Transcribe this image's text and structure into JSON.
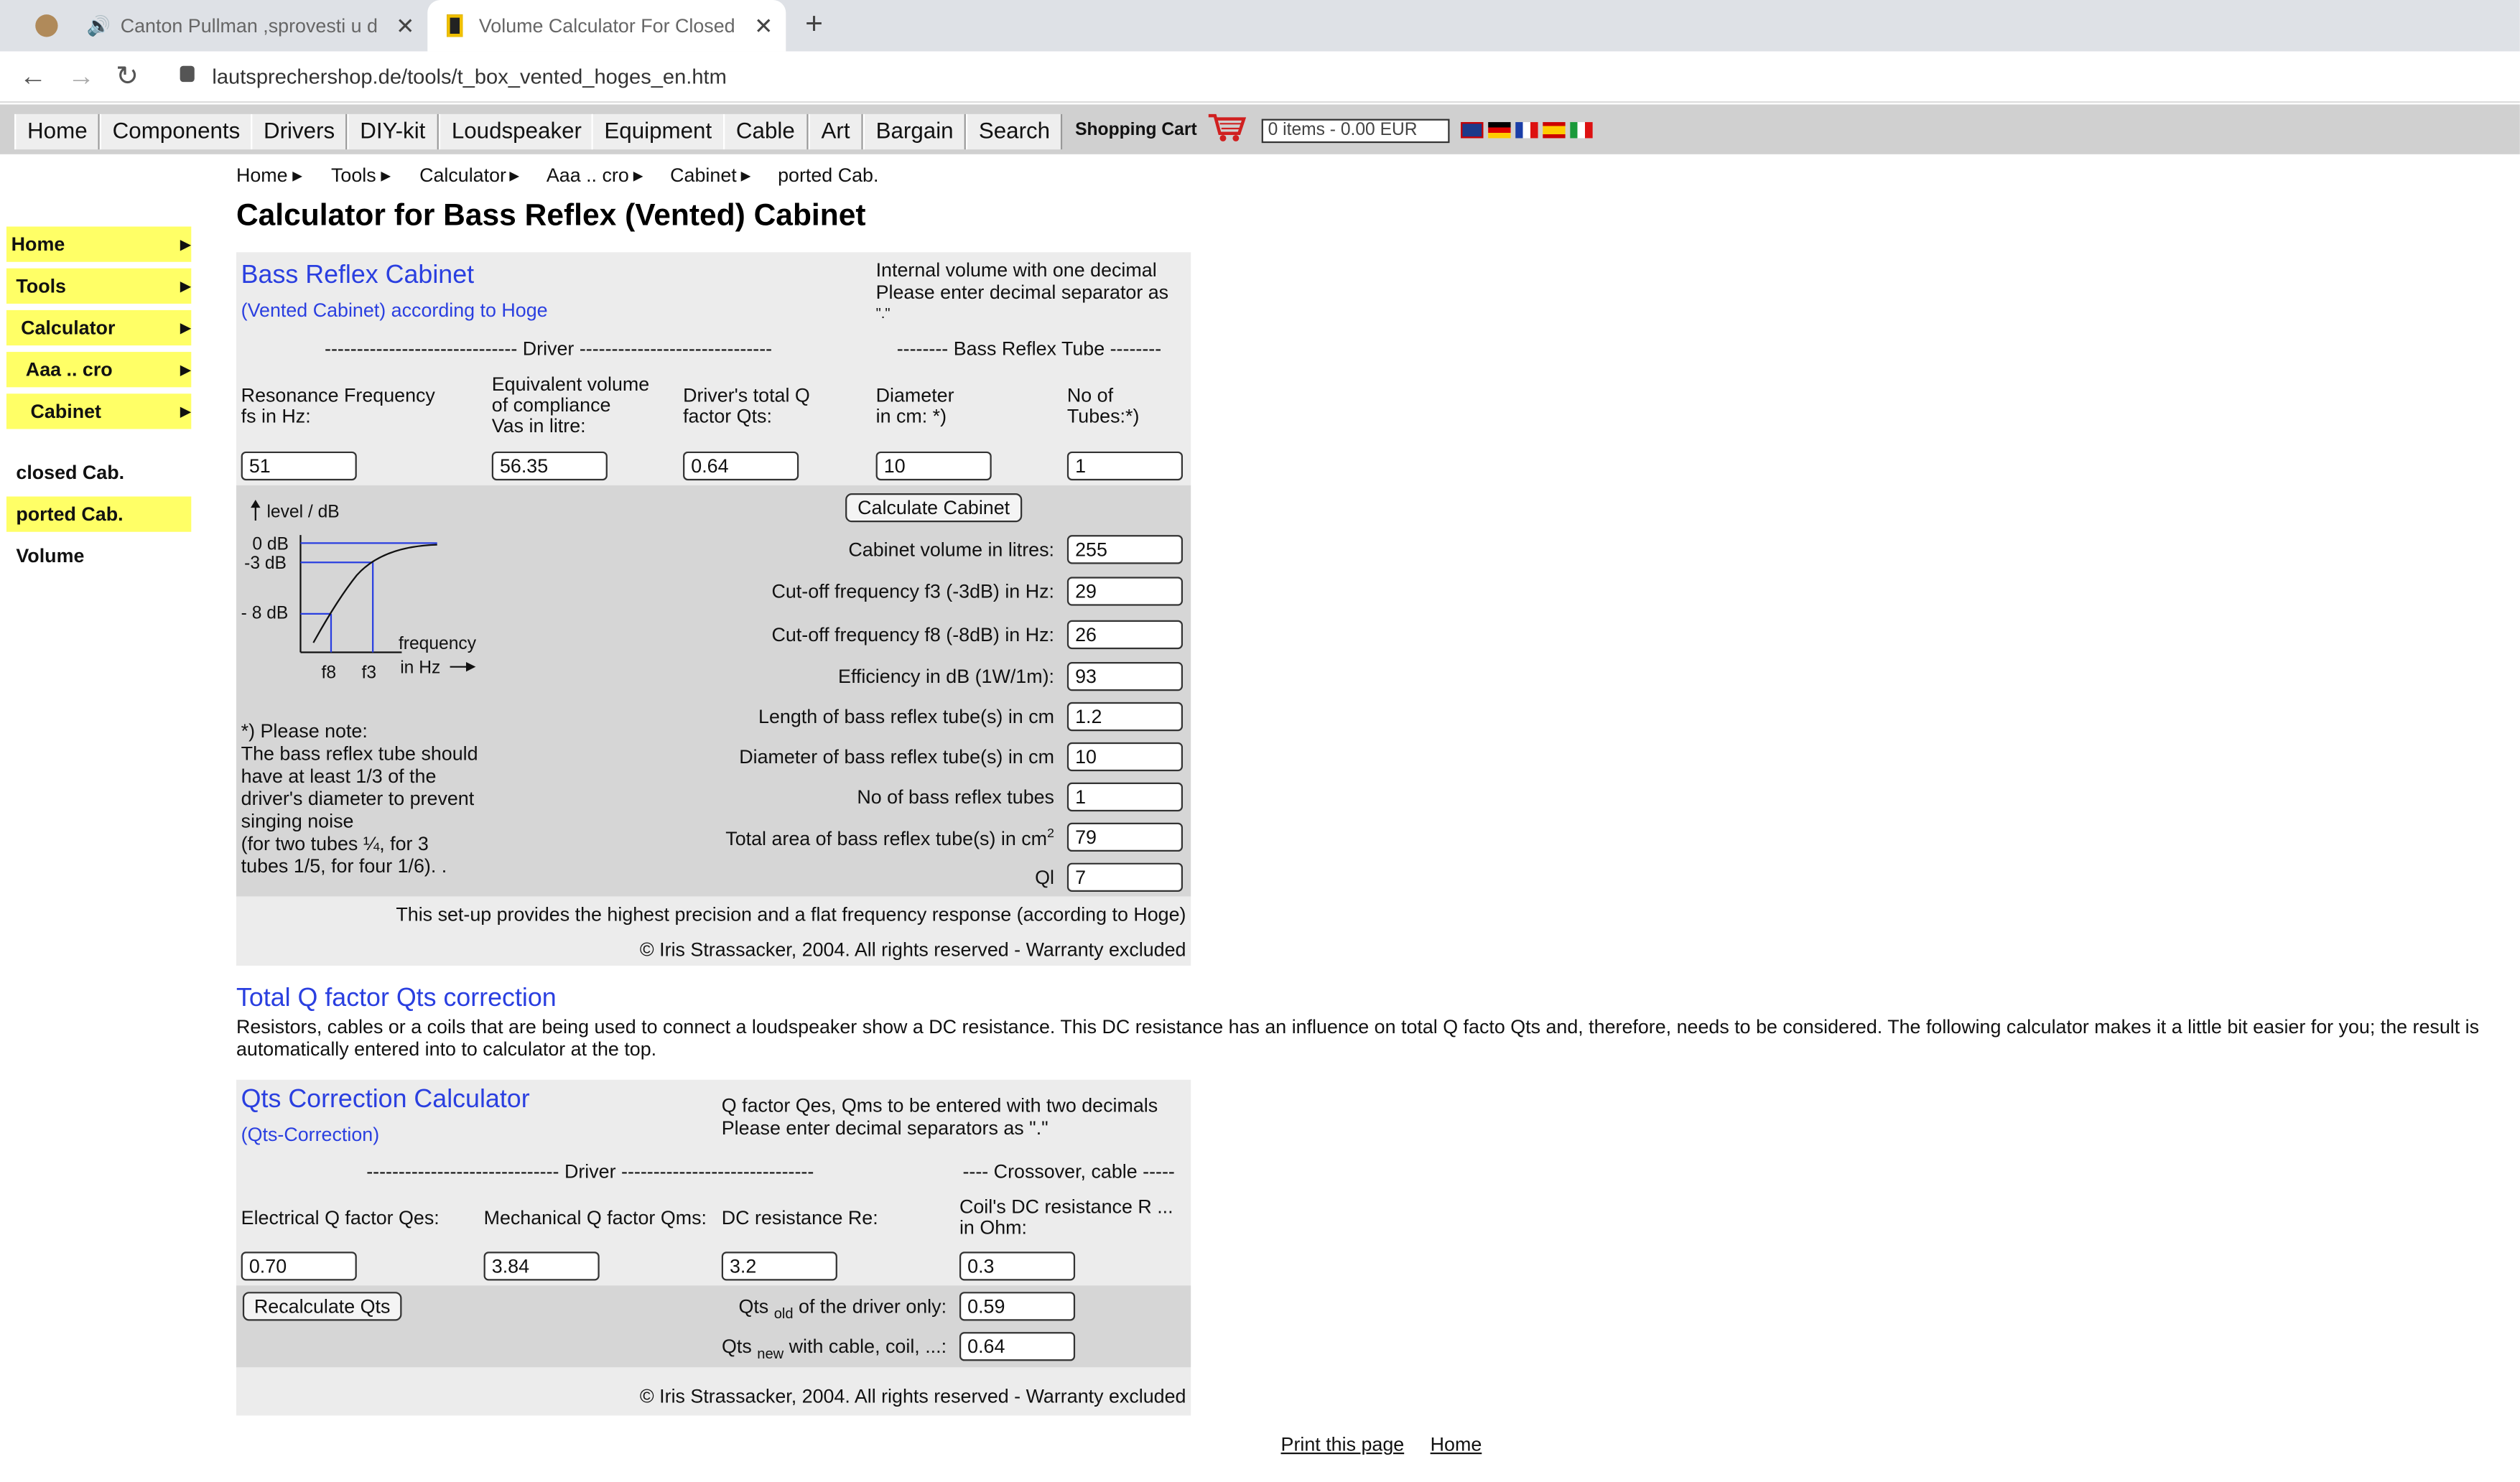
{
  "browser": {
    "tabs": [
      {
        "title": "Canton Pullman ,sprovesti u delo"
      },
      {
        "title": "Volume Calculator For Closed Lo"
      }
    ],
    "url": "lautsprechershop.de/tools/t_box_vented_hoges_en.htm"
  },
  "site_nav": {
    "items": [
      "Home",
      "Components",
      "Drivers",
      "DIY-kit",
      "Loudspeaker",
      "Equipment",
      "Cable",
      "Art",
      "Bargain",
      "Search"
    ],
    "cart_label": "Shopping Cart",
    "cart_value": "0 items - 0.00 EUR"
  },
  "sidebar": {
    "items": [
      {
        "label": "Home"
      },
      {
        "label": "Tools"
      },
      {
        "label": "Calculator"
      },
      {
        "label": "Aaa .. cro"
      },
      {
        "label": "Cabinet"
      },
      {
        "label": "closed Cab."
      },
      {
        "label": "ported Cab."
      },
      {
        "label": "Volume"
      }
    ]
  },
  "breadcrumb": [
    "Home",
    "Tools",
    "Calculator",
    "Aaa .. cro",
    "Cabinet",
    "ported Cab."
  ],
  "page_title": "Calculator for Bass Reflex (Vented) Cabinet",
  "bass_reflex": {
    "title": "Bass Reflex Cabinet",
    "subtitle": "(Vented Cabinet) according to Hoge",
    "note_line1": "Internal volume with one decimal",
    "note_line2": "Please enter decimal separator as",
    "note_line3": "\".\"",
    "driver_header": "------------------------------ Driver ------------------------------",
    "tube_header": "-------- Bass Reflex Tube --------",
    "inputs": [
      {
        "label1": "Resonance Frequency",
        "label2": "fs in Hz:",
        "label3": "",
        "value": "51"
      },
      {
        "label1": "Equivalent volume",
        "label2": "of compliance",
        "label3": "Vas in litre:",
        "value": "56.35"
      },
      {
        "label1": "Driver's total Q",
        "label2": "factor Qts:",
        "label3": "",
        "value": "0.64"
      },
      {
        "label1": "Diameter",
        "label2": "in cm: *)",
        "label3": "",
        "value": "10"
      },
      {
        "label1": "No of",
        "label2": "Tubes:*)",
        "label3": "",
        "value": "1"
      }
    ],
    "calc_button": "Calculate Cabinet",
    "results": [
      {
        "label": "Cabinet volume in litres:",
        "value": "255"
      },
      {
        "label": "Cut-off frequency f3 (-3dB) in Hz:",
        "value": "29"
      },
      {
        "label": "Cut-off frequency f8 (-8dB) in Hz:",
        "value": "26"
      },
      {
        "label": "Efficiency in dB (1W/1m):",
        "value": "93"
      },
      {
        "label": "Length of bass reflex tube(s) in cm",
        "value": "1.2"
      },
      {
        "label": "Diameter of bass reflex tube(s) in cm",
        "value": "10"
      },
      {
        "label": "No of bass reflex tubes",
        "value": "1"
      },
      {
        "label": "Total area of bass reflex tube(s) in cm",
        "label_sup": "2",
        "value": "79"
      },
      {
        "label": "Ql",
        "value": "7"
      }
    ],
    "graph": {
      "ylabel": "level  / dB",
      "ticks": [
        "0 dB",
        "-3 dB",
        "- 8 dB"
      ],
      "xlabel1": "frequency",
      "xlabel2": "in Hz",
      "f8": "f8",
      "f3": "f3"
    },
    "note": [
      "*) Please note:",
      "The bass reflex tube should",
      "have at least 1/3 of the",
      "driver's diameter to prevent",
      "singing noise",
      "(for two tubes ¼, for 3",
      "tubes 1/5, for four 1/6). ."
    ],
    "precision_text": "This set-up provides the highest precision and a flat frequency response (according to Hoge)",
    "copyright": "© Iris Strassacker, 2004. All rights reserved - Warranty excluded"
  },
  "qts_section": {
    "heading": "Total Q factor Qts correction",
    "para_line1": "Resistors, cables or a coils that are being used to connect a loudspeaker show a DC resistance. This DC resistance has an influence on total Q facto Qts and, therefore, needs to be considered. The following calculator makes it a little bit easier for you; the result is",
    "para_line2": "automatically entered into to calculator at the top."
  },
  "qts_calc": {
    "title": "Qts Correction Calculator",
    "subtitle": "(Qts-Correction)",
    "note_line1": "Q factor Qes, Qms to be entered with two decimals",
    "note_line2": "Please enter decimal separators as \".\"",
    "driver_header": "------------------------------ Driver ------------------------------",
    "crossover_header": "---- Crossover, cable -----",
    "inputs": [
      {
        "label1": "Electrical Q factor Qes:",
        "label2": "",
        "value": "0.70"
      },
      {
        "label1": "Mechanical Q factor Qms:",
        "label2": "",
        "value": "3.84"
      },
      {
        "label1": "DC resistance Re:",
        "label2": "",
        "value": "3.2"
      },
      {
        "label1": "Coil's DC resistance R ...",
        "label2": "in Ohm:",
        "value": "0.3"
      }
    ],
    "recalc_button": "Recalculate Qts",
    "qts_old_prefix": "Qts",
    "qts_old_sub": "old",
    "qts_old_suffix": " of the driver only:",
    "qts_old_value": "0.59",
    "qts_new_prefix": "Qts",
    "qts_new_sub": "new",
    "qts_new_suffix": " with cable, coil, ...:",
    "qts_new_value": "0.64",
    "copyright": "© Iris Strassacker, 2004. All rights reserved - Warranty excluded"
  },
  "footer": {
    "print": "Print this page",
    "home": "Home"
  }
}
